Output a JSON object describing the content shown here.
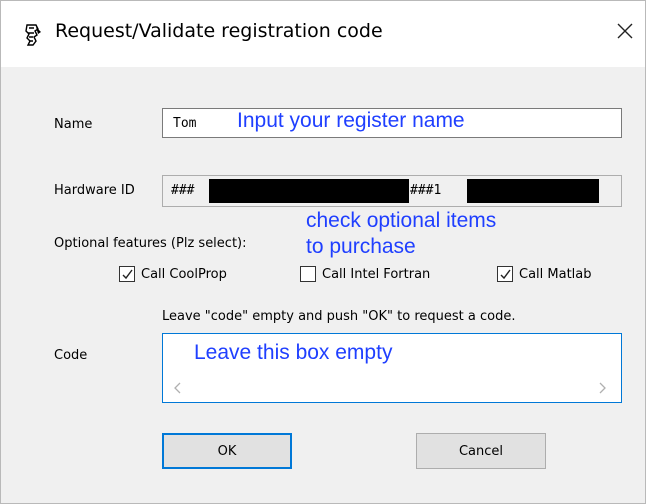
{
  "window": {
    "title": "Request/Validate registration code",
    "icon": "app-logo-icon",
    "close_icon": "close-icon"
  },
  "form": {
    "name_label": "Name",
    "name_value": "Tom",
    "hardware_label": "Hardware ID",
    "hardware_prefix": "###",
    "hardware_mid": "###1",
    "optional_label": "Optional features (Plz select):",
    "options": [
      {
        "label": "Call CoolProp",
        "checked": true
      },
      {
        "label": "Call Intel Fortran",
        "checked": false
      },
      {
        "label": "Call Matlab",
        "checked": true
      }
    ],
    "code_hint": "Leave \"code\" empty and push \"OK\" to request a code.",
    "code_label": "Code",
    "code_value": ""
  },
  "buttons": {
    "ok": "OK",
    "cancel": "Cancel"
  },
  "annotations": {
    "name_note": "Input your register name",
    "options_note_1": "check optional items",
    "options_note_2": "to purchase",
    "code_note": "Leave this box empty"
  },
  "colors": {
    "annotation": "#1f3fff",
    "default_button_border": "#0078d7",
    "dialog_bg": "#f0f0f0"
  }
}
